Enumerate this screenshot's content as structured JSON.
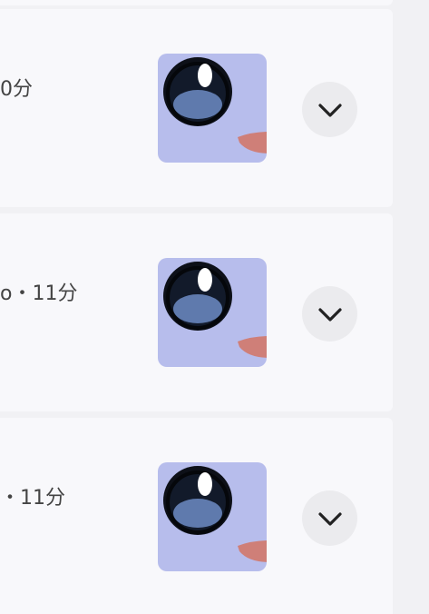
{
  "items": [
    {
      "meta": "0分",
      "thumbnail_icon": "anime-eye-icon",
      "expand_icon": "chevron-down-icon"
    },
    {
      "meta": "o・11分",
      "thumbnail_icon": "anime-eye-icon",
      "expand_icon": "chevron-down-icon"
    },
    {
      "meta": "・11分",
      "thumbnail_icon": "anime-eye-icon",
      "expand_icon": "chevron-down-icon"
    }
  ],
  "colors": {
    "page_bg": "#f1f1f4",
    "card_bg": "#f8f8fb",
    "thumb_bg": "#b7bdec",
    "button_bg": "#ebebee",
    "chevron": "#222222"
  }
}
